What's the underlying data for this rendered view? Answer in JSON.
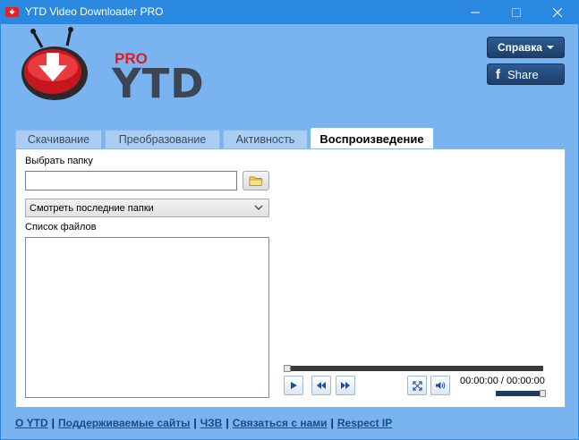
{
  "window": {
    "title": "YTD Video Downloader PRO"
  },
  "logo": {
    "pro": "PRO",
    "ytd": "YTD"
  },
  "header": {
    "help_label": "Справка",
    "share_label": "Share",
    "fb_glyph": "f"
  },
  "tabs": [
    {
      "label": "Скачивание",
      "active": false
    },
    {
      "label": "Преобразование",
      "active": false
    },
    {
      "label": "Активность",
      "active": false
    },
    {
      "label": "Воспроизведение",
      "active": true
    }
  ],
  "playback": {
    "folder_label": "Выбрать папку",
    "folder_value": "",
    "recent_folders": "Смотреть последние папки",
    "files_label": "Список файлов",
    "time": "00:00:00 / 00:00:00",
    "seek_fraction": 0,
    "volume_fraction": 1
  },
  "footer": {
    "links": [
      "О YTD",
      "Поддерживаемые сайты",
      "ЧЗВ",
      "Связаться с нами",
      "Respect IP"
    ],
    "separator": "|"
  },
  "colors": {
    "accent": "#2b88e0",
    "client_bg": "#79b3f0",
    "logo_red": "#e01b24",
    "logo_gray": "#3b4553"
  }
}
